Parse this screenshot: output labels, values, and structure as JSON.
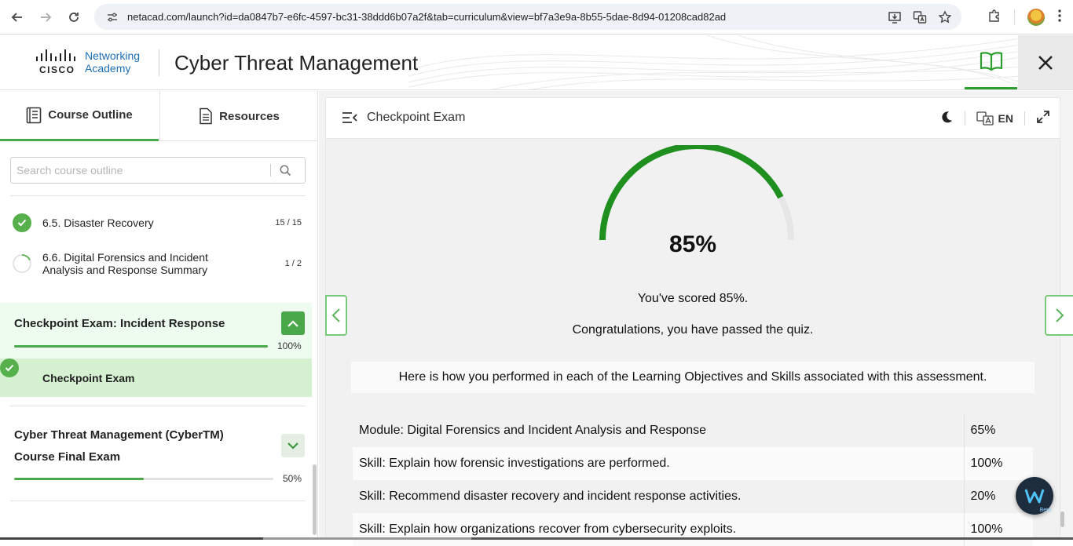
{
  "browser": {
    "url": "netacad.com/launch?id=da0847b7-e6fc-4597-bc31-38ddd6b07a2f&tab=curriculum&view=bf7a3e9a-8b55-5dae-8d94-01208cad82ad"
  },
  "header": {
    "brand_cisco": "CISCO",
    "brand_line1": "Networking",
    "brand_line2": "Academy",
    "course_title": "Cyber Threat Management"
  },
  "sidebar": {
    "tabs": [
      {
        "label": "Course Outline",
        "icon": "outline-icon",
        "active": true
      },
      {
        "label": "Resources",
        "icon": "document-icon",
        "active": false
      }
    ],
    "search_placeholder": "Search course outline",
    "items": [
      {
        "label": "6.5. Disaster Recovery",
        "count": "15 / 15",
        "status": "complete"
      },
      {
        "label_line1": "6.6. Digital Forensics and Incident",
        "label_line2": "Analysis and Response Summary",
        "count": "1 / 2",
        "status": "in-progress"
      }
    ],
    "checkpoint_section": {
      "title": "Checkpoint Exam: Incident Response",
      "progress": 100,
      "progress_label": "100%",
      "item_label": "Checkpoint Exam"
    },
    "final_section": {
      "title_line1": "Cyber Threat Management (CyberTM)",
      "title_line2": "Course Final Exam",
      "progress": 50,
      "progress_label": "50%"
    }
  },
  "content": {
    "title": "Checkpoint Exam",
    "language": "EN",
    "score_value": 85,
    "score_label": "85%",
    "scored_text": "You've scored 85%.",
    "congrats_text": "Congratulations, you have passed the quiz.",
    "performance_intro": "Here is how you performed in each of the Learning Objectives and Skills associated with this assessment.",
    "results": [
      {
        "label": "Module: Digital Forensics and Incident Analysis and Response",
        "score": "65%"
      },
      {
        "label": "Skill: Explain how forensic investigations are performed.",
        "score": "100%"
      },
      {
        "label": "Skill: Recommend disaster recovery and incident response activities.",
        "score": "20%"
      },
      {
        "label": "Skill: Explain how organizations recover from cybersecurity exploits.",
        "score": "100%"
      }
    ]
  },
  "chat": {
    "badge": "Beta"
  },
  "colors": {
    "accent_green": "#4aa84a",
    "gauge_green": "#1f8f1f",
    "cisco_blue": "#1d6fb8"
  }
}
